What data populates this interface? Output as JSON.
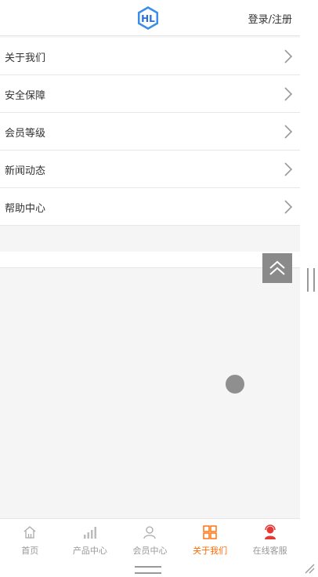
{
  "header": {
    "login_label": "登录/注册"
  },
  "menu": [
    {
      "label": "关于我们"
    },
    {
      "label": "安全保障"
    },
    {
      "label": "会员等级"
    },
    {
      "label": "新闻动态"
    },
    {
      "label": "帮助中心"
    }
  ],
  "tabbar": [
    {
      "label": "首页",
      "icon": "home-icon"
    },
    {
      "label": "产品中心",
      "icon": "signal-bars-icon"
    },
    {
      "label": "会员中心",
      "icon": "user-icon"
    },
    {
      "label": "关于我们",
      "icon": "grid-icon",
      "active": true
    },
    {
      "label": "在线客服",
      "icon": "customer-service-icon"
    }
  ],
  "colors": {
    "active": "#ff6a00",
    "brand_blue": "#2b6fd6",
    "service_red": "#e53935"
  }
}
